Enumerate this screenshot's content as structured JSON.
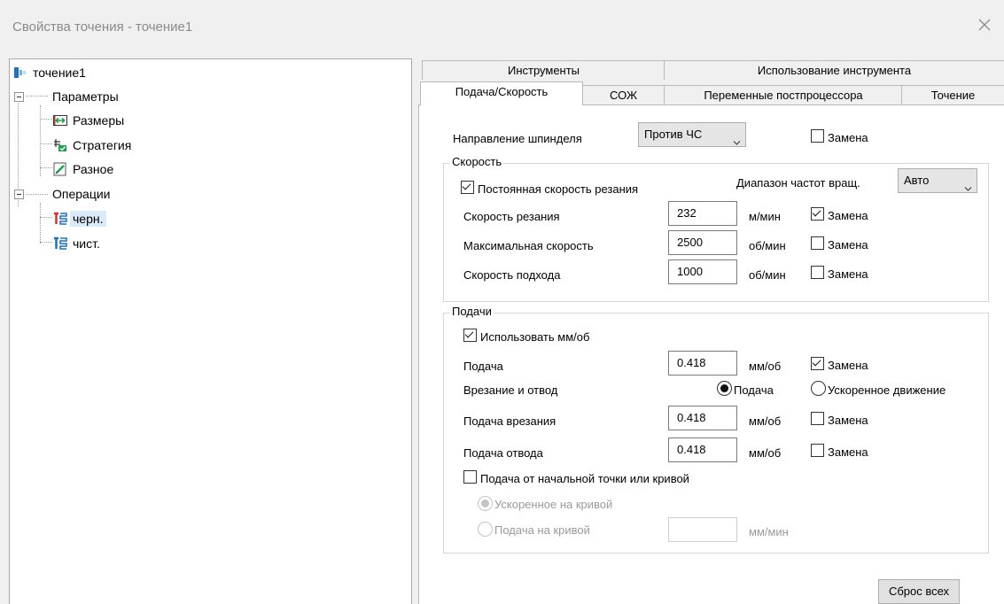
{
  "window": {
    "title": "Свойства точения - точение1"
  },
  "tree": {
    "root": "точение1",
    "params": "Параметры",
    "sizes": "Размеры",
    "strategy": "Стратегия",
    "misc": "Разное",
    "operations": "Операции",
    "rough": "черн.",
    "finish": "чист."
  },
  "tabs": {
    "tools": "Инструменты",
    "tool_usage": "Использование инструмента",
    "feed_speed": "Подача/Скорость",
    "coolant": "СОЖ",
    "post_vars": "Переменные постпроцессора",
    "turning": "Точение"
  },
  "spindle": {
    "label": "Направление шпинделя",
    "value": "Против ЧС",
    "override": "Замена"
  },
  "speed_group": {
    "title": "Скорость",
    "constant": "Постоянная скорость резания",
    "range_label": "Диапазон частот вращ.",
    "range_value": "Авто",
    "cut_label": "Скорость резания",
    "cut_value": "232",
    "cut_unit": "м/мин",
    "cut_override": "Замена",
    "max_label": "Максимальная скорость",
    "max_value": "2500",
    "max_unit": "об/мин",
    "max_override": "Замена",
    "approach_label": "Скорость подхода",
    "approach_value": "1000",
    "approach_unit": "об/мин",
    "approach_override": "Замена"
  },
  "feed_group": {
    "title": "Подачи",
    "use_mmrev": "Использовать мм/об",
    "feed_label": "Подача",
    "feed_value": "0.418",
    "feed_unit": "мм/об",
    "feed_override": "Замена",
    "plunge_retract": "Врезание и отвод",
    "radio_feed": "Подача",
    "radio_rapid": "Ускоренное движение",
    "plunge_label": "Подача врезания",
    "plunge_value": "0.418",
    "plunge_unit": "мм/об",
    "plunge_override": "Замена",
    "retract_label": "Подача отвода",
    "retract_value": "0.418",
    "retract_unit": "мм/об",
    "retract_override": "Замена",
    "from_start": "Подача от начальной точки или кривой",
    "rapid_on_curve": "Ускоренное на кривой",
    "feed_on_curve": "Подача на кривой",
    "curve_unit": "мм/мин"
  },
  "reset_button": "Сброс всех",
  "icons": [
    "close-icon",
    "turning-op-icon",
    "expander-icon",
    "dimensions-icon",
    "strategy-icon",
    "misc-icon",
    "toolpath-icon",
    "chevron-down-icon"
  ],
  "colors": {
    "selection": "#d9eaf9",
    "accent_blue": "#1e73be",
    "accent_red": "#e0302c",
    "accent_green": "#1aa34a"
  }
}
